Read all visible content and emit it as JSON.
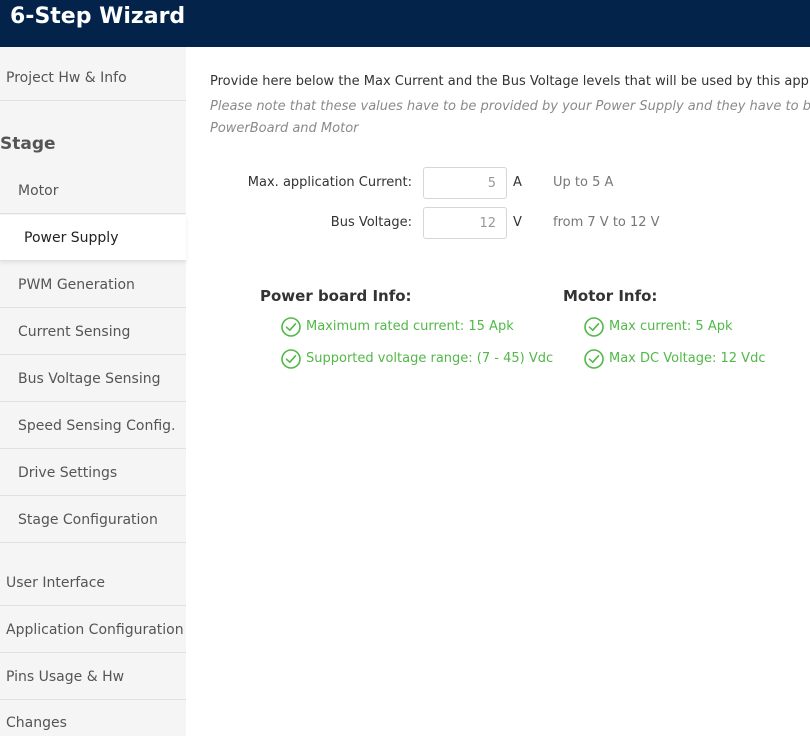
{
  "header": {
    "title": "6-Step Wizard"
  },
  "sidebar": {
    "top_items": [
      {
        "label": "Project Hw & Info"
      }
    ],
    "section": "Stage",
    "stage_items": [
      {
        "label": "Motor"
      },
      {
        "label": "Power Supply",
        "active": true
      },
      {
        "label": "PWM Generation"
      },
      {
        "label": "Current Sensing"
      },
      {
        "label": "Bus Voltage Sensing"
      },
      {
        "label": "Speed Sensing Config."
      },
      {
        "label": "Drive Settings"
      },
      {
        "label": "Stage Configuration"
      }
    ],
    "bottom_items": [
      {
        "label": "User Interface"
      },
      {
        "label": "Application Configuration"
      },
      {
        "label": "Pins Usage & Hw Changes"
      }
    ]
  },
  "main": {
    "intro": "Provide here below the Max Current and the Bus Voltage levels that will be used by this applicatio",
    "note_line1": "Please note that these values have to be provided by your Power Supply and they have to be compa",
    "note_line2": "PowerBoard and Motor",
    "fields": [
      {
        "label": "Max. application Current:",
        "value": "5",
        "unit": "A",
        "hint": "Up to 5 A"
      },
      {
        "label": "Bus Voltage:",
        "value": "12",
        "unit": "V",
        "hint": "from 7 V to 12 V"
      }
    ],
    "power_board": {
      "title": "Power board Info:",
      "lines": [
        "Maximum rated current: 15 Apk",
        "Supported voltage range: (7 - 45) Vdc"
      ]
    },
    "motor": {
      "title": "Motor Info:",
      "lines": [
        "Max current: 5 Apk",
        "Max DC Voltage: 12 Vdc"
      ]
    }
  },
  "colors": {
    "header_bg": "#03234b",
    "ok_green": "#52b848",
    "sidebar_bg": "#f5f5f5"
  },
  "icons": {
    "ok": "check-circle-icon"
  }
}
